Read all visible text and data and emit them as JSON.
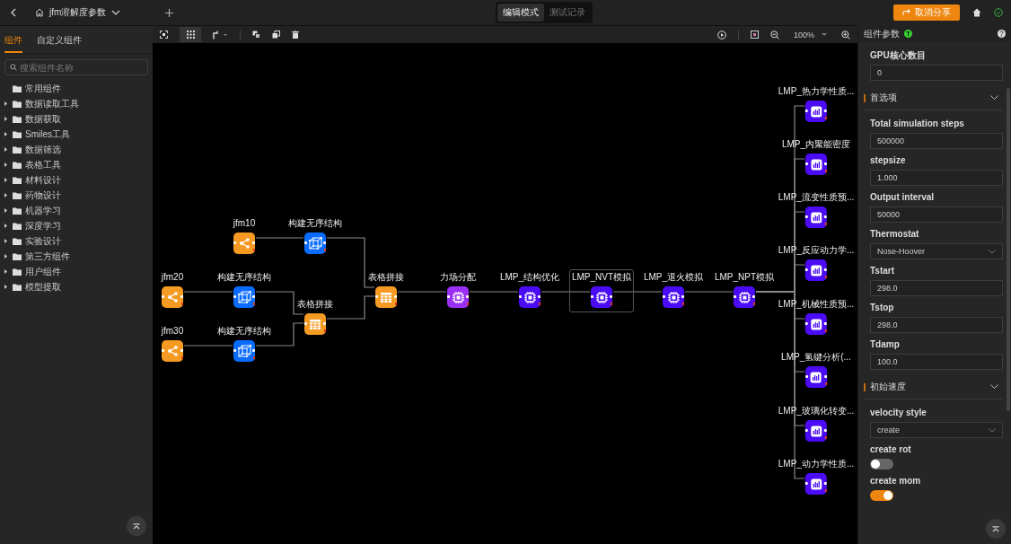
{
  "top_bar": {
    "title": "jfm溶解度参数",
    "mode_tabs": [
      {
        "label": "编辑模式",
        "selected": true
      },
      {
        "label": "测试记录",
        "selected": false
      }
    ],
    "share_button": "取消分享"
  },
  "sidebar": {
    "tabs": [
      {
        "label": "组件",
        "selected": true
      },
      {
        "label": "自定义组件",
        "selected": false
      }
    ],
    "search": {
      "placeholder": "搜索组件名称"
    },
    "items": [
      {
        "label": "常用组件",
        "expandable": false
      },
      {
        "label": "数据读取工具",
        "expandable": true
      },
      {
        "label": "数据获取",
        "expandable": true
      },
      {
        "label": "Smiles工具",
        "expandable": true
      },
      {
        "label": "数据筛选",
        "expandable": true
      },
      {
        "label": "表格工具",
        "expandable": true
      },
      {
        "label": "材料设计",
        "expandable": true
      },
      {
        "label": "药物设计",
        "expandable": true
      },
      {
        "label": "机器学习",
        "expandable": true
      },
      {
        "label": "深度学习",
        "expandable": true
      },
      {
        "label": "实验设计",
        "expandable": true
      },
      {
        "label": "第三方组件",
        "expandable": true
      },
      {
        "label": "用户组件",
        "expandable": true
      },
      {
        "label": "模型提取",
        "expandable": true
      }
    ]
  },
  "toolbar": {
    "zoom": "100%"
  },
  "canvas": {
    "nodes": [
      {
        "label": "jfm10",
        "kind": "share",
        "color": "#f59a23",
        "selected": false
      },
      {
        "label": "构建无序结构",
        "kind": "cube",
        "color": "#0a6cff",
        "selected": false
      },
      {
        "label": "jfm20",
        "kind": "share",
        "color": "#f59a23",
        "selected": false
      },
      {
        "label": "构建无序结构",
        "kind": "cube",
        "color": "#0a6cff",
        "selected": false
      },
      {
        "label": "表格拼接",
        "kind": "table",
        "color": "#f59a23",
        "selected": false
      },
      {
        "label": "jfm30",
        "kind": "share",
        "color": "#f59a23",
        "selected": false
      },
      {
        "label": "构建无序结构",
        "kind": "cube",
        "color": "#0a6cff",
        "selected": false
      },
      {
        "label": "表格拼接",
        "kind": "table",
        "color": "#f59a23",
        "selected": false
      },
      {
        "label": "力场分配",
        "kind": "chip",
        "color": "#9b30f5",
        "selected": false
      },
      {
        "label": "LMP_结构优化",
        "kind": "chip",
        "color": "#4b0cf5",
        "selected": false
      },
      {
        "label": "LMP_NVT模拟",
        "kind": "chip",
        "color": "#4b0cf5",
        "selected": true
      },
      {
        "label": "LMP_退火模拟",
        "kind": "chip",
        "color": "#4b0cf5",
        "selected": false
      },
      {
        "label": "LMP_NPT模拟",
        "kind": "chip",
        "color": "#4b0cf5",
        "selected": false
      },
      {
        "label": "LMP_热力学性质...",
        "kind": "chart",
        "color": "#4b0cf5",
        "selected": false
      },
      {
        "label": "LMP_内聚能密度",
        "kind": "chart",
        "color": "#4b0cf5",
        "selected": false
      },
      {
        "label": "LMP_流变性质预...",
        "kind": "chart",
        "color": "#4b0cf5",
        "selected": false
      },
      {
        "label": "LMP_反应动力学...",
        "kind": "chart",
        "color": "#4b0cf5",
        "selected": false
      },
      {
        "label": "LMP_机械性质预...",
        "kind": "chart",
        "color": "#4b0cf5",
        "selected": false
      },
      {
        "label": "LMP_氢键分析(...",
        "kind": "chart",
        "color": "#4b0cf5",
        "selected": false
      },
      {
        "label": "LMP_玻璃化转变...",
        "kind": "chart",
        "color": "#4b0cf5",
        "selected": false
      },
      {
        "label": "LMP_动力学性质...",
        "kind": "chart",
        "color": "#4b0cf5",
        "selected": false
      }
    ]
  },
  "panel": {
    "title": "组件参数",
    "fields": [
      {
        "kind": "input",
        "label": "GPU核心数目",
        "value": "0"
      }
    ],
    "sections": [
      {
        "title": "首选项",
        "expanded": true,
        "fields": [
          {
            "kind": "input",
            "label": "Total simulation steps",
            "value": "500000"
          },
          {
            "kind": "input",
            "label": "stepsize",
            "value": "1.000"
          },
          {
            "kind": "input",
            "label": "Output interval",
            "value": "50000"
          },
          {
            "kind": "select",
            "label": "Thermostat",
            "value": "Nose-Hoover"
          },
          {
            "kind": "input",
            "label": "Tstart",
            "value": "298.0"
          },
          {
            "kind": "input",
            "label": "Tstop",
            "value": "298.0"
          },
          {
            "kind": "input",
            "label": "Tdamp",
            "value": "100.0"
          }
        ]
      },
      {
        "title": "初始速度",
        "expanded": true,
        "fields": [
          {
            "kind": "select",
            "label": "velocity style",
            "value": "create"
          },
          {
            "kind": "toggle",
            "label": "create rot",
            "on": false
          },
          {
            "kind": "toggle",
            "label": "create mom",
            "on": true
          }
        ]
      }
    ]
  }
}
